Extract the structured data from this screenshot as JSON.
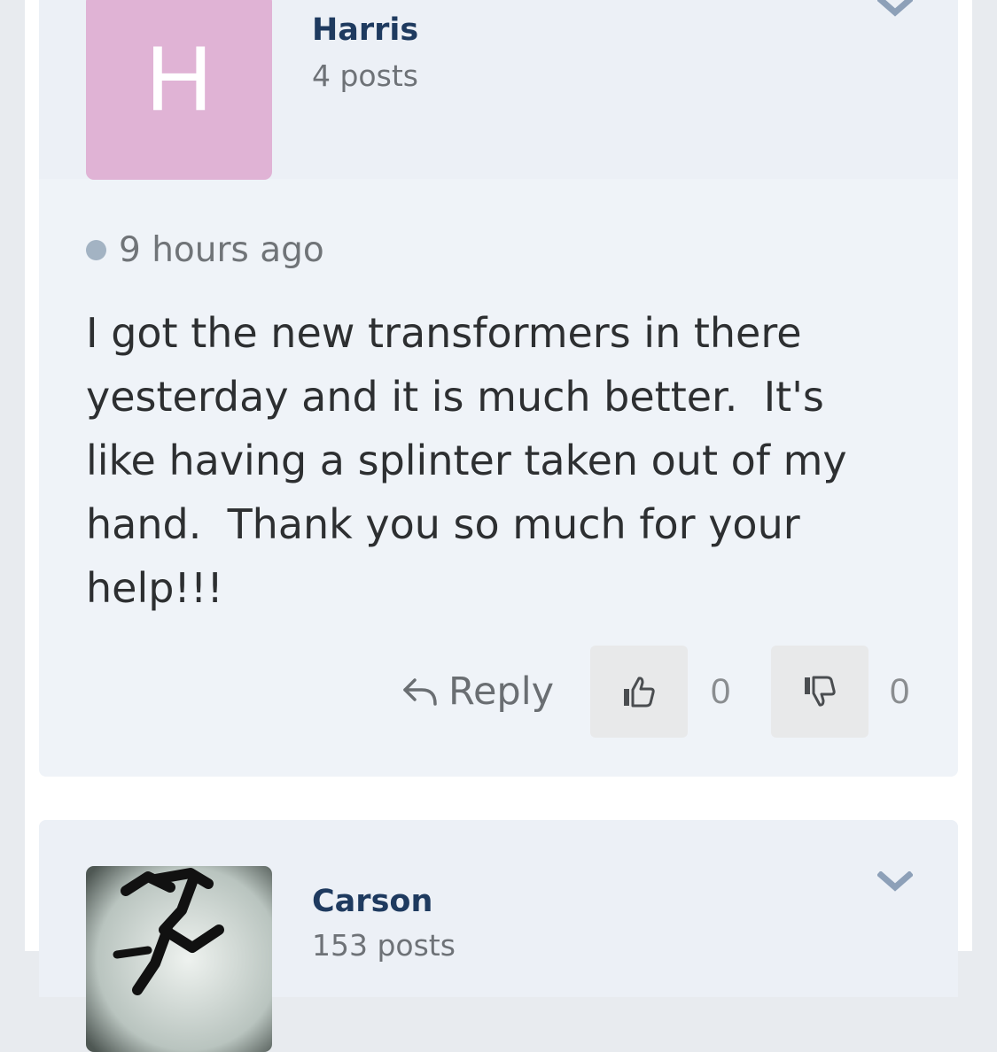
{
  "posts": [
    {
      "author": {
        "initial": "H",
        "name": "Harris",
        "posts_count": "4 posts",
        "avatar_color": "#e0b3d5"
      },
      "timestamp": "9 hours ago",
      "body": "I got the new transformers in there\nyesterday and it is much better.  It's\nlike having a splinter taken out of my\nhand.  Thank you so much for your\nhelp!!!",
      "actions": {
        "reply_label": "Reply",
        "upvote_count": "0",
        "downvote_count": "0"
      }
    },
    {
      "author": {
        "name": "Carson",
        "posts_count": "153 posts"
      }
    }
  ],
  "icons": {
    "menu": "chevron-down-icon",
    "reply": "reply-arrow-icon",
    "upvote": "thumbs-up-icon",
    "downvote": "thumbs-down-icon",
    "status": "status-dot-icon"
  },
  "colors": {
    "author_name": "#1e3a5f",
    "card_background": "#eff3f8",
    "chevron": "#8da0b8"
  }
}
